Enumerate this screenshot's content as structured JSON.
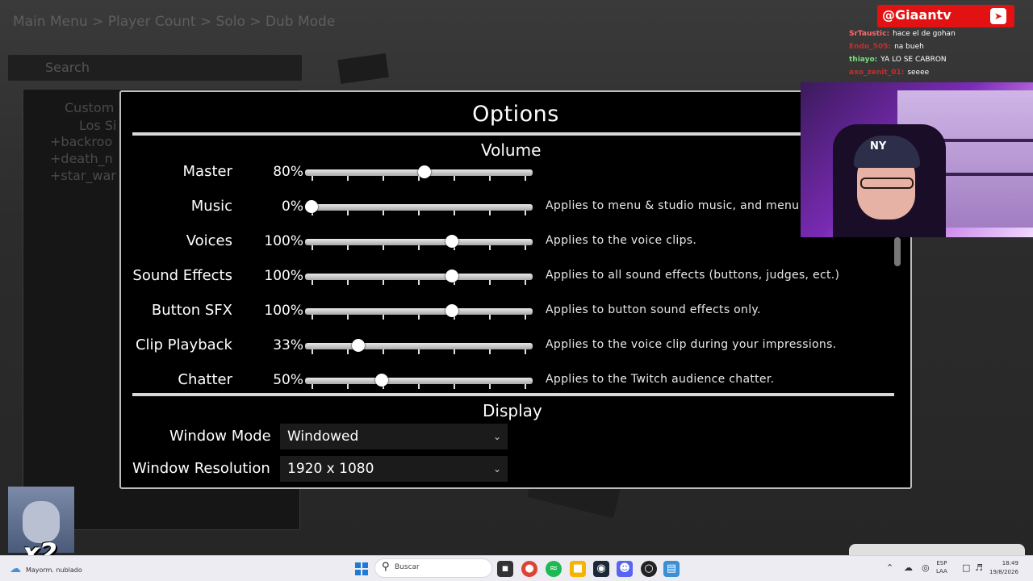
{
  "background": {
    "breadcrumb": "Main Menu > Player Count > Solo > Dub Mode",
    "search_placeholder": "Search",
    "tree_items": [
      "Custom",
      "Los Si",
      "+backroo",
      "+death_n",
      "+star_war"
    ]
  },
  "dialog": {
    "title": "Options",
    "volume_title": "Volume",
    "volume_rows": [
      {
        "label": "Master",
        "percent": "80%",
        "value": 0.8,
        "knob": 0.53,
        "desc": ""
      },
      {
        "label": "Music",
        "percent": "0%",
        "value": 0.0,
        "knob": 0.0,
        "desc": "Applies to menu & studio music, and menu vid"
      },
      {
        "label": "Voices",
        "percent": "100%",
        "value": 1.0,
        "knob": 0.66,
        "desc": "Applies to the voice clips."
      },
      {
        "label": "Sound Effects",
        "percent": "100%",
        "value": 1.0,
        "knob": 0.66,
        "desc": "Applies to all sound effects (buttons, judges, ect.)"
      },
      {
        "label": "Button SFX",
        "percent": "100%",
        "value": 1.0,
        "knob": 0.66,
        "desc": "Applies to button sound effects only."
      },
      {
        "label": "Clip Playback",
        "percent": "33%",
        "value": 0.33,
        "knob": 0.22,
        "desc": "Applies to the voice clip during your impressions."
      },
      {
        "label": "Chatter",
        "percent": "50%",
        "value": 0.5,
        "knob": 0.33,
        "desc": "Applies to the Twitch audience chatter."
      }
    ],
    "display_title": "Display",
    "window_mode_label": "Window Mode",
    "window_mode_value": "Windowed",
    "window_resolution_label": "Window Resolution",
    "window_resolution_value": "1920 x 1080"
  },
  "stream": {
    "handle": "@Giaantv",
    "chat": [
      {
        "user": "SrTaustic:",
        "msg": "hace el de gohan",
        "color": "#ff6a6a"
      },
      {
        "user": "Endo_505:",
        "msg": "na bueh",
        "color": "#c03030"
      },
      {
        "user": "thiayo:",
        "msg": "YA LO SE CABRON",
        "color": "#7ddc7d"
      },
      {
        "user": "axo_zenit_01:",
        "msg": "seeee",
        "color": "#c03030"
      }
    ],
    "cam_logo": "NY",
    "emote_multiplier": "x2"
  },
  "taskbar": {
    "weather": "Mayorm. nublado",
    "search_placeholder": "Buscar",
    "lang_top": "ESP",
    "lang_bottom": "LAA",
    "time": "18:49",
    "date": "19/8/2026"
  }
}
